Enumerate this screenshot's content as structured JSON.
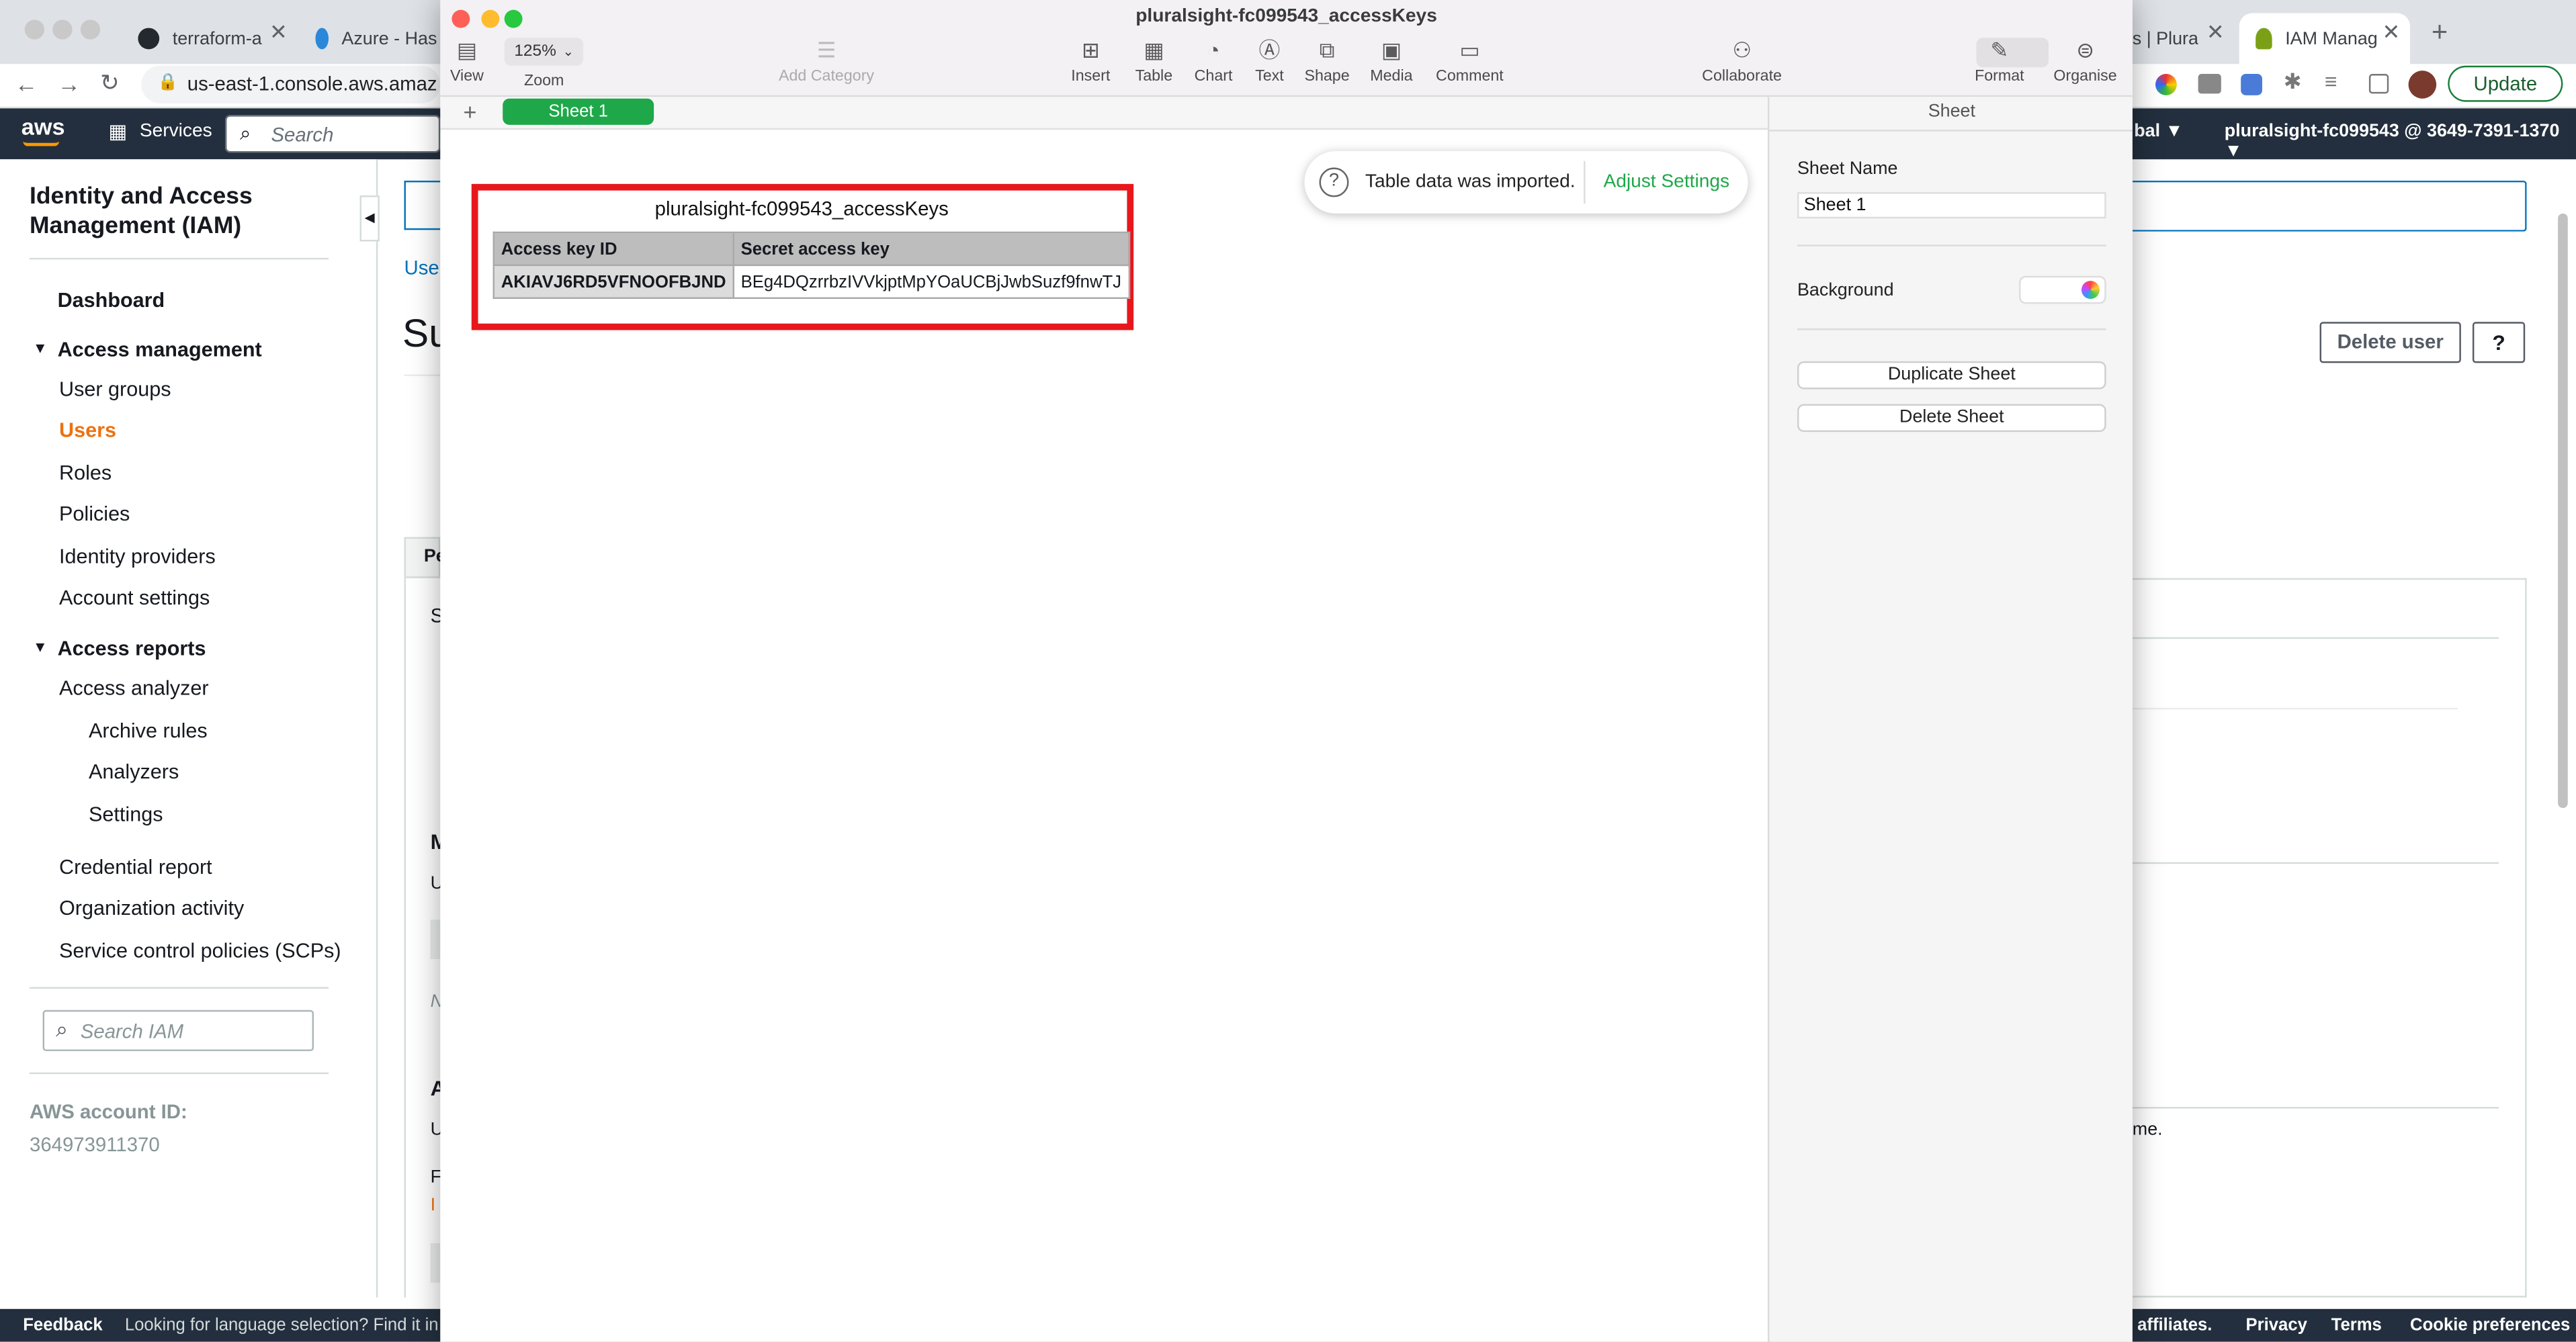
{
  "browser": {
    "tabs": [
      {
        "label": "terraform-a"
      },
      {
        "label": "Azure - Has"
      },
      {
        "label": "s | Plura"
      },
      {
        "label": "IAM Manag"
      }
    ],
    "url": "us-east-1.console.aws.amaz",
    "update_label": "Update"
  },
  "aws_nav": {
    "logo": "aws",
    "services": "Services",
    "search_placeholder": "Search",
    "region_fragment": "bal ▼",
    "account": "pluralsight-fc099543 @ 3649-7391-1370 ▼"
  },
  "iam": {
    "title": "Identity and Access Management (IAM)",
    "dashboard": "Dashboard",
    "access_management": "Access management",
    "am_items": [
      "User groups",
      "Users",
      "Roles",
      "Policies",
      "Identity providers",
      "Account settings"
    ],
    "access_reports": "Access reports",
    "ar_items": [
      "Access analyzer",
      "Archive rules",
      "Analyzers",
      "Settings",
      "Credential report",
      "Organization activity",
      "Service control policies (SCPs)"
    ],
    "search_placeholder": "Search IAM",
    "account_id_label": "AWS account ID:",
    "account_id": "364973911370",
    "breadcrumb_fragment": "User",
    "heading_fragment": "Su",
    "delete_user": "Delete user",
    "help": "?",
    "tab_fragment": "Pe",
    "frag_s": "S",
    "frag_m": "M",
    "frag_u": "U",
    "frag_n": "N",
    "frag_a": "A",
    "frag_u2": "U",
    "frag_f": "F",
    "frag_i": "I",
    "frag_me": "me."
  },
  "footer": {
    "feedback": "Feedback",
    "notice": "Looking for language selection? Find it in th",
    "affiliates": "affiliates.",
    "privacy": "Privacy",
    "terms": "Terms",
    "cookies": "Cookie preferences"
  },
  "numbers": {
    "title": "pluralsight-fc099543_accessKeys",
    "zoom": "125%",
    "toolbar": {
      "view": "View",
      "zoom": "Zoom",
      "add_category": "Add Category",
      "insert": "Insert",
      "table": "Table",
      "chart": "Chart",
      "text": "Text",
      "shape": "Shape",
      "media": "Media",
      "comment": "Comment",
      "collaborate": "Collaborate",
      "format": "Format",
      "organise": "Organise"
    },
    "sheet_tab": "Sheet 1",
    "add_sheet": "+",
    "notice": "Table data was imported.",
    "adjust_settings": "Adjust Settings",
    "table": {
      "title": "pluralsight-fc099543_accessKeys",
      "headers": [
        "Access key ID",
        "Secret access key"
      ],
      "row": [
        "AKIAVJ6RD5VFNOOFBJND",
        "BEg4DQzrrbzIVVkjptMpYOaUCBjJwbSuzf9fnwTJ"
      ]
    },
    "panel": {
      "header": "Sheet",
      "sheet_name_label": "Sheet Name",
      "sheet_name_value": "Sheet 1",
      "background_label": "Background",
      "duplicate": "Duplicate Sheet",
      "delete": "Delete Sheet"
    }
  },
  "colors": {
    "aws_nav": "#232f3e",
    "aws_orange": "#ec7211",
    "numbers_green": "#1ea849",
    "highlight_red": "#e8171c"
  }
}
